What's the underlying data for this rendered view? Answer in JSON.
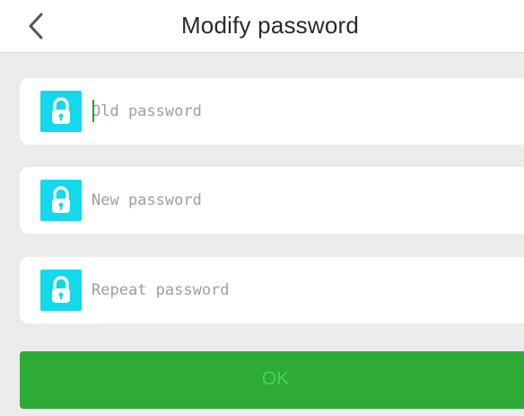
{
  "header": {
    "title": "Modify password",
    "back_icon": "chevron-left-icon"
  },
  "fields": [
    {
      "placeholder": "Old password",
      "icon": "lock-icon",
      "focused": true
    },
    {
      "placeholder": "New password",
      "icon": "lock-icon",
      "focused": false
    },
    {
      "placeholder": "Repeat password",
      "icon": "lock-icon",
      "focused": false
    }
  ],
  "submit": {
    "label": "OK"
  },
  "colors": {
    "background": "#ececec",
    "lock_tile": "#14d8ec",
    "button": "#2eaa36",
    "button_text": "#46d34e",
    "caret": "#1fa21f"
  }
}
